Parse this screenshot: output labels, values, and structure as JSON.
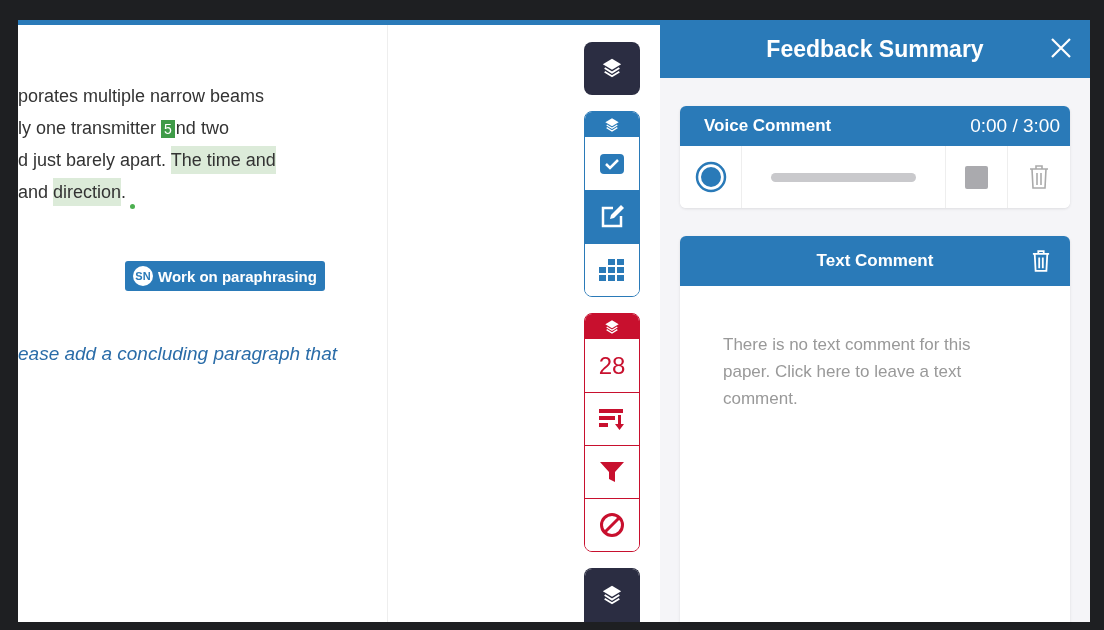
{
  "document": {
    "lines": [
      {
        "segments": [
          {
            "kind": "plain",
            "text": "porates multiple narrow beams"
          }
        ]
      },
      {
        "segments": [
          {
            "kind": "plain",
            "text": "ly one transmitter "
          },
          {
            "kind": "marker",
            "text": "5"
          },
          {
            "kind": "plain",
            "text": "nd two"
          }
        ]
      },
      {
        "segments": [
          {
            "kind": "plain",
            "text": "d just barely apart. "
          },
          {
            "kind": "highlight",
            "text": "The time and"
          }
        ]
      },
      {
        "segments": [
          {
            "kind": "plain",
            "text": "and "
          },
          {
            "kind": "highlight",
            "text": "direction"
          },
          {
            "kind": "plain",
            "text": "."
          }
        ]
      }
    ],
    "tag": {
      "initials": "SN",
      "label": "Work on paraphrasing"
    },
    "comment": "ease add a concluding paragraph that"
  },
  "toolbar": [
    {
      "color": "#2b2d42"
    },
    {
      "color": "#2a7ab8",
      "items": [
        {
          "kind": "check",
          "selected": false
        },
        {
          "kind": "edit",
          "selected": true
        },
        {
          "kind": "grid",
          "selected": false
        }
      ]
    },
    {
      "color": "#c8102e",
      "items": [
        {
          "kind": "count",
          "text": "28"
        },
        {
          "kind": "sort"
        },
        {
          "kind": "filter"
        },
        {
          "kind": "block"
        }
      ]
    },
    {
      "color": "#2b2d42"
    }
  ],
  "panel": {
    "title": "Feedback Summary",
    "voice": {
      "title": "Voice Comment",
      "time": "0:00 / 3:00"
    },
    "text_comment": {
      "title": "Text Comment",
      "message": "There is no text comment for this paper. Click here to leave a text comment."
    }
  }
}
